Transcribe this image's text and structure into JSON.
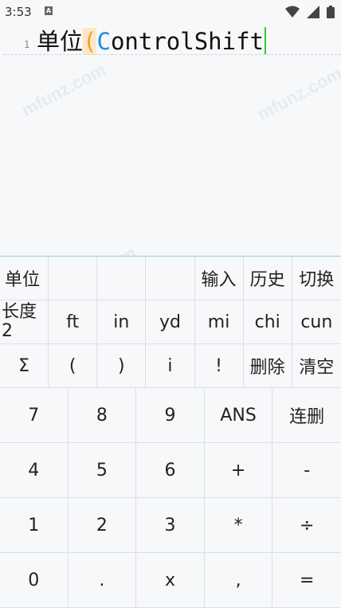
{
  "status": {
    "time": "3:53",
    "a_label": "A"
  },
  "editor": {
    "line_number": "1",
    "text_cjk": "单位",
    "paren": "(",
    "first_char": "C",
    "rest": "ontrolShift"
  },
  "watermark": "mfunz.com",
  "function_rows": [
    [
      "单位",
      "",
      "",
      "",
      "输入",
      "历史",
      "切换"
    ],
    [
      "长度\n2",
      "ft",
      "in",
      "yd",
      "mi",
      "chi",
      "cun"
    ],
    [
      "Σ",
      "(",
      ")",
      "i",
      "!",
      "删除",
      "清空"
    ]
  ],
  "keypad_rows": [
    [
      "7",
      "8",
      "9",
      "ANS",
      "连删"
    ],
    [
      "4",
      "5",
      "6",
      "+",
      "-"
    ],
    [
      "1",
      "2",
      "3",
      "*",
      "÷"
    ],
    [
      "0",
      ".",
      "x",
      ",",
      "="
    ]
  ],
  "accents": {
    "paren": "#f0a020",
    "first_char": "#1a8fe0",
    "cursor": "#33cc33"
  }
}
